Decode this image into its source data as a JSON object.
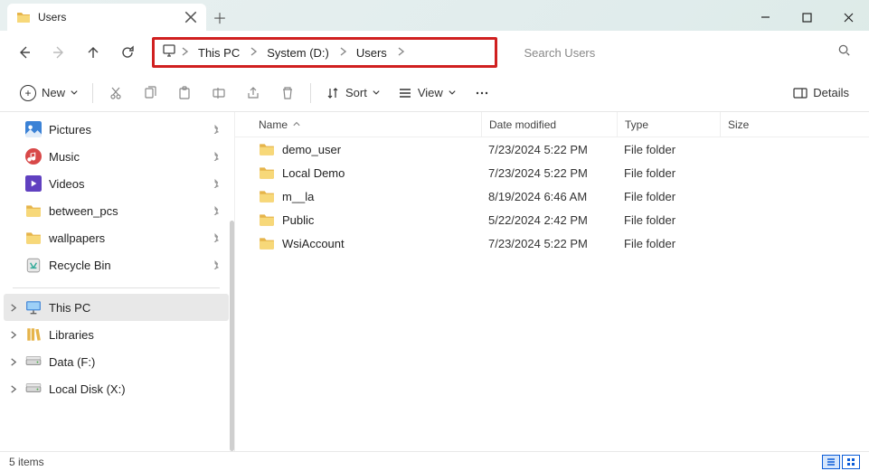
{
  "tab": {
    "title": "Users"
  },
  "breadcrumb": {
    "parts": [
      "This PC",
      "System (D:)",
      "Users"
    ]
  },
  "search": {
    "placeholder": "Search Users"
  },
  "toolbar": {
    "new": "New",
    "sort": "Sort",
    "view": "View",
    "details": "Details"
  },
  "columns": {
    "name": "Name",
    "date": "Date modified",
    "type": "Type",
    "size": "Size"
  },
  "sidebar": {
    "quick": [
      {
        "label": "Pictures",
        "icon": "pictures"
      },
      {
        "label": "Music",
        "icon": "music"
      },
      {
        "label": "Videos",
        "icon": "videos"
      },
      {
        "label": "between_pcs",
        "icon": "folder"
      },
      {
        "label": "wallpapers",
        "icon": "folder"
      },
      {
        "label": "Recycle Bin",
        "icon": "recycle"
      }
    ],
    "tree": [
      {
        "label": "This PC",
        "icon": "pc",
        "selected": true
      },
      {
        "label": "Libraries",
        "icon": "libraries"
      },
      {
        "label": "Data (F:)",
        "icon": "drive"
      },
      {
        "label": "Local Disk (X:)",
        "icon": "drive"
      }
    ]
  },
  "files": [
    {
      "name": "demo_user",
      "date": "7/23/2024 5:22 PM",
      "type": "File folder"
    },
    {
      "name": "Local Demo",
      "date": "7/23/2024 5:22 PM",
      "type": "File folder"
    },
    {
      "name": "m__la",
      "date": "8/19/2024 6:46 AM",
      "type": "File folder"
    },
    {
      "name": "Public",
      "date": "5/22/2024 2:42 PM",
      "type": "File folder"
    },
    {
      "name": "WsiAccount",
      "date": "7/23/2024 5:22 PM",
      "type": "File folder"
    }
  ],
  "status": {
    "text": "5 items"
  }
}
